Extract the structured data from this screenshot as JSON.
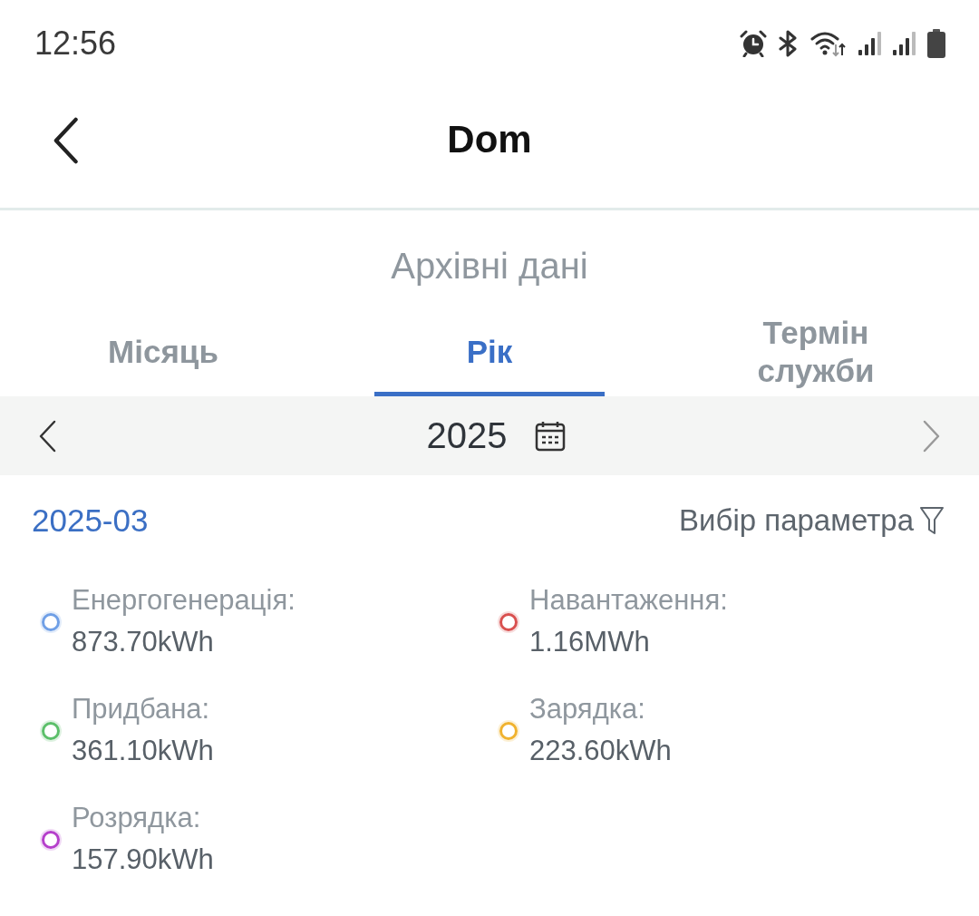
{
  "status_bar": {
    "time": "12:56"
  },
  "header": {
    "title": "Dom"
  },
  "section_title": "Архівні дані",
  "tabs": [
    {
      "label": "Місяць",
      "selected": false
    },
    {
      "label": "Рік",
      "selected": true
    },
    {
      "label": "Термін служби",
      "selected": false
    }
  ],
  "period_bar": {
    "year": "2025"
  },
  "selected_period": "2025-03",
  "filter": {
    "label": "Вибір параметра"
  },
  "legend": [
    {
      "label": "Енергогенерація:",
      "value": "873.70kWh",
      "color": "#6f9fe6"
    },
    {
      "label": "Навантаження:",
      "value": "1.16MWh",
      "color": "#d9504f"
    },
    {
      "label": "Придбана:",
      "value": "361.10kWh",
      "color": "#5cbf6a"
    },
    {
      "label": "Зарядка:",
      "value": "223.60kWh",
      "color": "#f0b22e"
    },
    {
      "label": "Розрядка:",
      "value": "157.90kWh",
      "color": "#b53fcb"
    }
  ]
}
